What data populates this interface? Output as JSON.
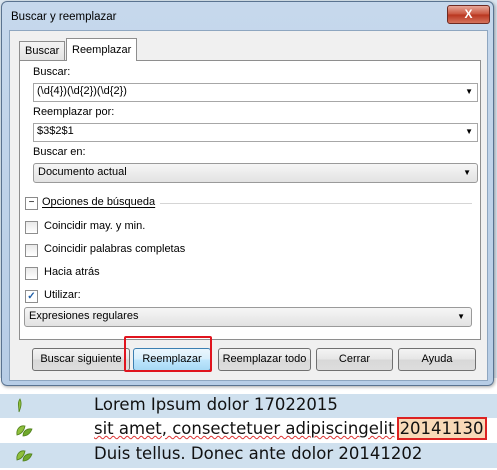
{
  "window": {
    "title": "Buscar y reemplazar",
    "close_label": "X"
  },
  "tabs": [
    {
      "label": "Buscar",
      "active": false
    },
    {
      "label": "Reemplazar",
      "active": true
    }
  ],
  "search": {
    "label": "Buscar:",
    "value": "(\\d{4})(\\d{2})(\\d{2})"
  },
  "replace": {
    "label": "Reemplazar por:",
    "value": "$3$2$1"
  },
  "scope": {
    "label": "Buscar en:",
    "value": "Documento actual"
  },
  "options": {
    "header": "Opciones de búsqueda",
    "collapse_symbol": "−",
    "match_case": {
      "label": "Coincidir may. y min.",
      "checked": false
    },
    "whole_words": {
      "label": "Coincidir palabras completas",
      "checked": false
    },
    "backwards": {
      "label": "Hacia atrás",
      "checked": false
    },
    "use": {
      "label": "Utilizar:",
      "checked": true,
      "check_mark": "✓"
    },
    "mode": {
      "value": "Expresiones regulares"
    }
  },
  "buttons": {
    "find_next": "Buscar siguiente",
    "replace": "Reemplazar",
    "replace_all": "Reemplazar todo",
    "close": "Cerrar",
    "help": "Ayuda"
  },
  "document": {
    "lines": [
      {
        "text": "Lorem Ipsum dolor 17022015"
      },
      {
        "text": "sit amet, consectetuer adipiscingelit",
        "match": "20141130"
      },
      {
        "text": "Duis tellus. Donec ante dolor 20141202"
      }
    ]
  },
  "colors": {
    "highlight_border": "#e0141e",
    "match_background": "#f8d9b8",
    "row_alt": "#cfe0ee"
  },
  "icons": [
    "leaf-icon",
    "checkbox-icon",
    "dropdown-arrow-icon",
    "collapse-icon",
    "close-icon"
  ]
}
